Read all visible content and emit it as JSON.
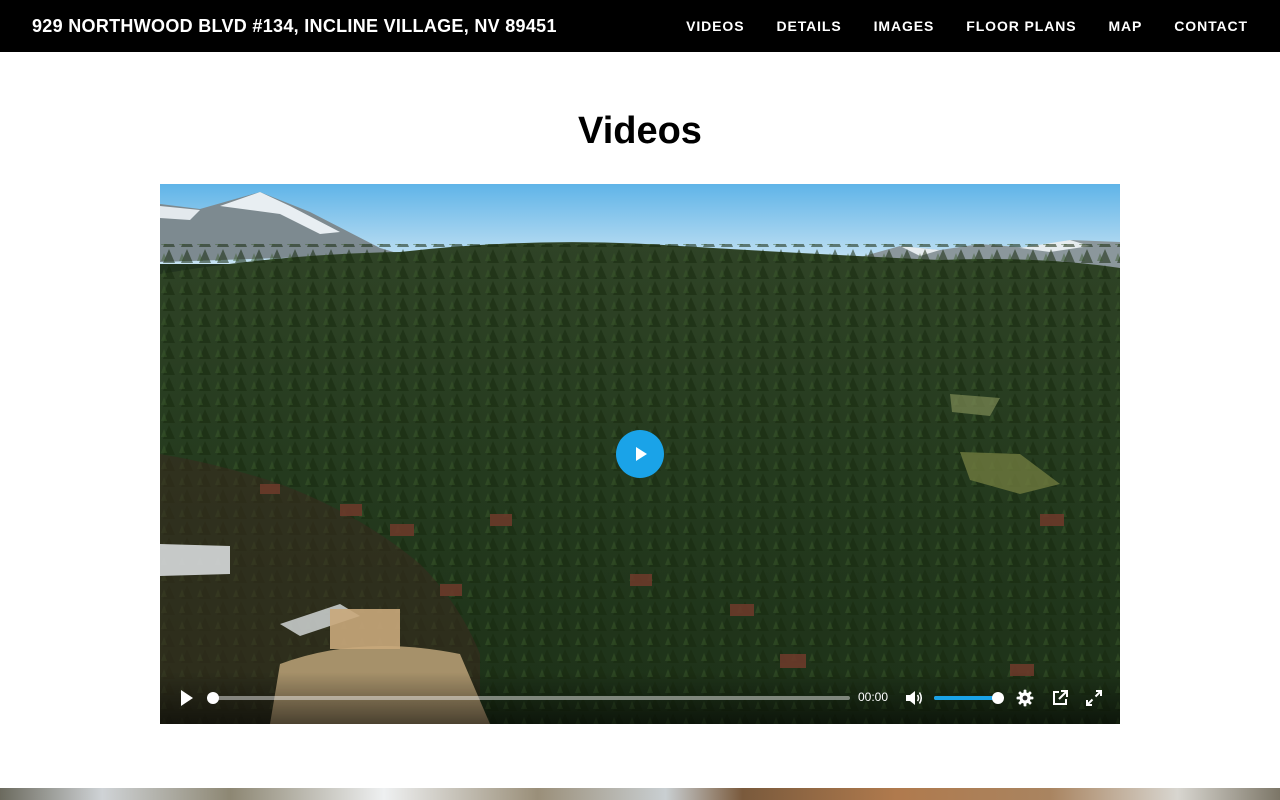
{
  "header": {
    "title": "929 NORTHWOOD BLVD #134, INCLINE VILLAGE, NV 89451",
    "nav": [
      {
        "label": "VIDEOS"
      },
      {
        "label": "DETAILS"
      },
      {
        "label": "IMAGES"
      },
      {
        "label": "FLOOR PLANS"
      },
      {
        "label": "MAP"
      },
      {
        "label": "CONTACT"
      }
    ]
  },
  "section": {
    "title": "Videos"
  },
  "player": {
    "current_time": "00:00",
    "progress": 0,
    "volume": 1.0,
    "accent_color": "#1aa3e8",
    "icons": {
      "big_play": "play-icon",
      "play": "play-icon",
      "volume": "volume-icon",
      "settings": "gear-icon",
      "popout": "external-link-icon",
      "fullscreen": "fullscreen-icon"
    }
  }
}
